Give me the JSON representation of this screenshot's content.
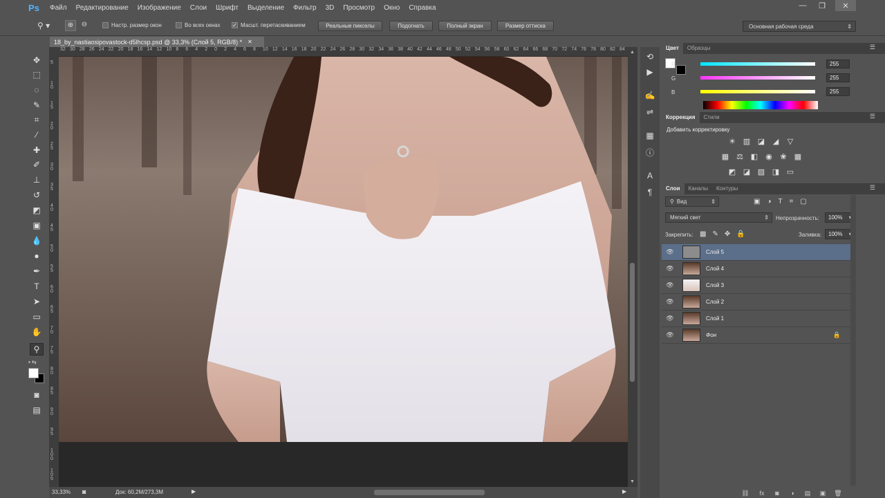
{
  "app": {
    "logo": "Ps"
  },
  "menu": [
    "Файл",
    "Редактирование",
    "Изображение",
    "Слои",
    "Шрифт",
    "Выделение",
    "Фильтр",
    "3D",
    "Просмотр",
    "Окно",
    "Справка"
  ],
  "window_controls": {
    "minimize": "—",
    "restore": "❐",
    "close": "✕"
  },
  "options": {
    "resize_windows": "Настр. размер окон",
    "all_windows": "Во всех окнах",
    "scrubby_zoom": "Масшт. перетаскиванием",
    "actual_pixels": "Реальные пикселы",
    "fit_screen": "Подогнать",
    "fill_screen": "Полный экран",
    "print_size": "Размер оттиска",
    "workspace": "Основная рабочая среда",
    "scrubby_checked": "✓"
  },
  "document": {
    "tab_title": "18_by_nastiaosipovastock-d5lhcsp.psd @ 33,3% (Слой 5, RGB/8) *",
    "close": "✕",
    "hruler_ticks": [
      "32",
      "30",
      "28",
      "26",
      "24",
      "22",
      "20",
      "18",
      "16",
      "14",
      "12",
      "10",
      "8",
      "6",
      "4",
      "2",
      "0",
      "2",
      "4",
      "6",
      "8",
      "10",
      "12",
      "14",
      "16",
      "18",
      "20",
      "22",
      "24",
      "26",
      "28",
      "30",
      "32",
      "34",
      "36",
      "38",
      "40",
      "42",
      "44",
      "46",
      "48",
      "50",
      "52",
      "54",
      "56",
      "58",
      "60",
      "62",
      "64",
      "66",
      "68",
      "70",
      "72",
      "74",
      "76",
      "78",
      "80",
      "82",
      "84"
    ],
    "vruler_ticks": [
      "5",
      "1 0",
      "1 5",
      "2 0",
      "2 5",
      "3 0",
      "3 5",
      "4 0",
      "4 5",
      "5 0",
      "5 5",
      "6 0",
      "6 5",
      "7 0",
      "7 5",
      "8 0",
      "8 5",
      "9 0",
      "9 5",
      "1 0 0",
      "1 0 5"
    ],
    "zoom": "33,33%",
    "doc_size": "Док: 60,2M/273,3M"
  },
  "color_panel": {
    "tabs": [
      "Цвет",
      "Образцы"
    ],
    "channels": [
      {
        "label": "R",
        "value": "255",
        "gradient": "#00e6ff,#ffffff"
      },
      {
        "label": "G",
        "value": "255",
        "gradient": "#ff33ff,#ffffff"
      },
      {
        "label": "B",
        "value": "255",
        "gradient": "#ffff00,#ffffff"
      }
    ]
  },
  "adjustments_panel": {
    "tabs": [
      "Коррекция",
      "Стили"
    ],
    "title": "Добавить корректировку",
    "row1_icons": [
      "☀",
      "▥",
      "◪",
      "◢",
      "▽"
    ],
    "row2_icons": [
      "▦",
      "⚖",
      "◧",
      "◉",
      "❀",
      "▦"
    ],
    "row3_icons": [
      "◩",
      "◪",
      "▨",
      "◨",
      "▭"
    ]
  },
  "layers_panel": {
    "tabs": [
      "Слои",
      "Каналы",
      "Контуры"
    ],
    "filter_kind": "Вид",
    "blend_mode": "Мягкий свет",
    "opacity_label": "Непрозрачность:",
    "opacity_value": "100%",
    "lock_label": "Закрепить:",
    "fill_label": "Заливка:",
    "fill_value": "100%",
    "layers": [
      {
        "name": "Слой 5",
        "thumb": "#8c8c8c"
      },
      {
        "name": "Слой 4",
        "thumb": "#7a5a4a"
      },
      {
        "name": "Слой 3",
        "thumb": "#ece6e2"
      },
      {
        "name": "Слой 2",
        "thumb": "#7a5a4a"
      },
      {
        "name": "Слой 1",
        "thumb": "#7a5a4a"
      },
      {
        "name": "Фон",
        "thumb": "#7a5a4a"
      }
    ],
    "bottom_icons": [
      "⛓",
      "fx",
      "◙",
      "◑",
      "▤",
      "▣",
      "🗑"
    ]
  }
}
